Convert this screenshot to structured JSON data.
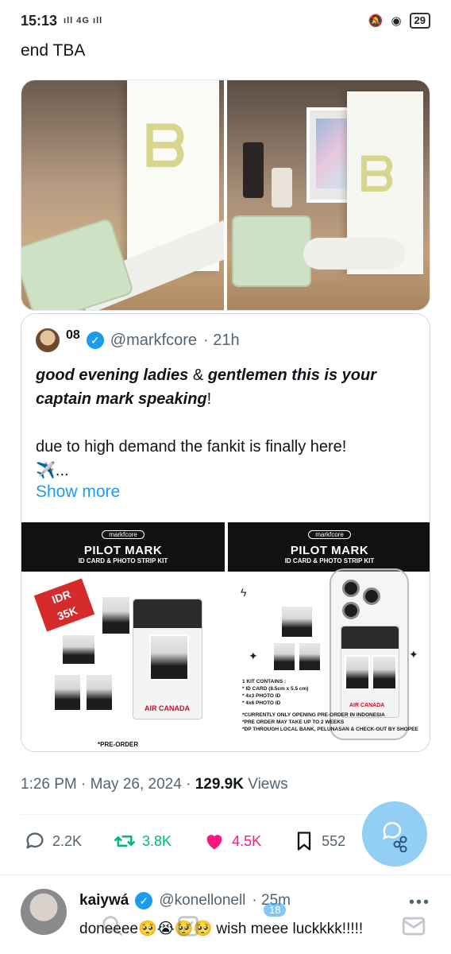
{
  "status_bar": {
    "time": "15:13",
    "signal": "4G",
    "battery": "29"
  },
  "tweet": {
    "text": "end TBA"
  },
  "quote": {
    "name": "08",
    "handle": "@markfcore",
    "time": "· 21h",
    "text_bold_1": "good evening ladies",
    "text_plain_1": " & ",
    "text_bold_2": "gentlemen this is your captain mark speaking",
    "text_plain_2": "!",
    "text_line_2": "due to high demand the fankit is finally here!",
    "text_line_3": "✈️...",
    "show_more": "Show more",
    "kits": [
      {
        "brand": "markfcore",
        "title": "PILOT MARK",
        "subtitle": "ID CARD & PHOTO STRIP KIT",
        "price_badge": "IDR\n35K",
        "airline": "AIR CANADA",
        "note": "*PRE-ORDER"
      },
      {
        "brand": "markfcore",
        "title": "PILOT MARK",
        "subtitle": "ID CARD & PHOTO STRIP KIT",
        "contains_title": "1 KIT CONTAINS :",
        "contains": [
          "* ID CARD (8.5cm x 5.5 cm)",
          "* 4x3 PHOTO ID",
          "* 4x6 PHOTO ID"
        ],
        "notes": [
          "*CURRENTLY ONLY OPENING PRE-ORDER IN INDONESIA",
          "*PRE ORDER MAY TAKE UP TO 2 WEEKS",
          "*DP THROUGH LOCAL BANK, PELUNASAN & CHECK-OUT BY SHOPEE"
        ],
        "airline": "AIR CANADA"
      }
    ]
  },
  "meta": {
    "time": "1:26 PM",
    "date": "May 26, 2024",
    "views_count": "129.9K",
    "views_label": "Views"
  },
  "actions": {
    "replies": "2.2K",
    "retweets": "3.8K",
    "likes": "4.5K",
    "bookmarks": "552"
  },
  "reply": {
    "name": "kaiywá",
    "handle": "@konellonell",
    "time": "· 25m",
    "text": "doneeee🥺😭🥺🥺 wish meee luckkkk!!!!!"
  },
  "nav": {
    "notifications_badge": "18"
  },
  "colors": {
    "accent": "#1d9bf0",
    "retweet": "#00ba7c",
    "like": "#f91880",
    "muted": "#536471"
  }
}
